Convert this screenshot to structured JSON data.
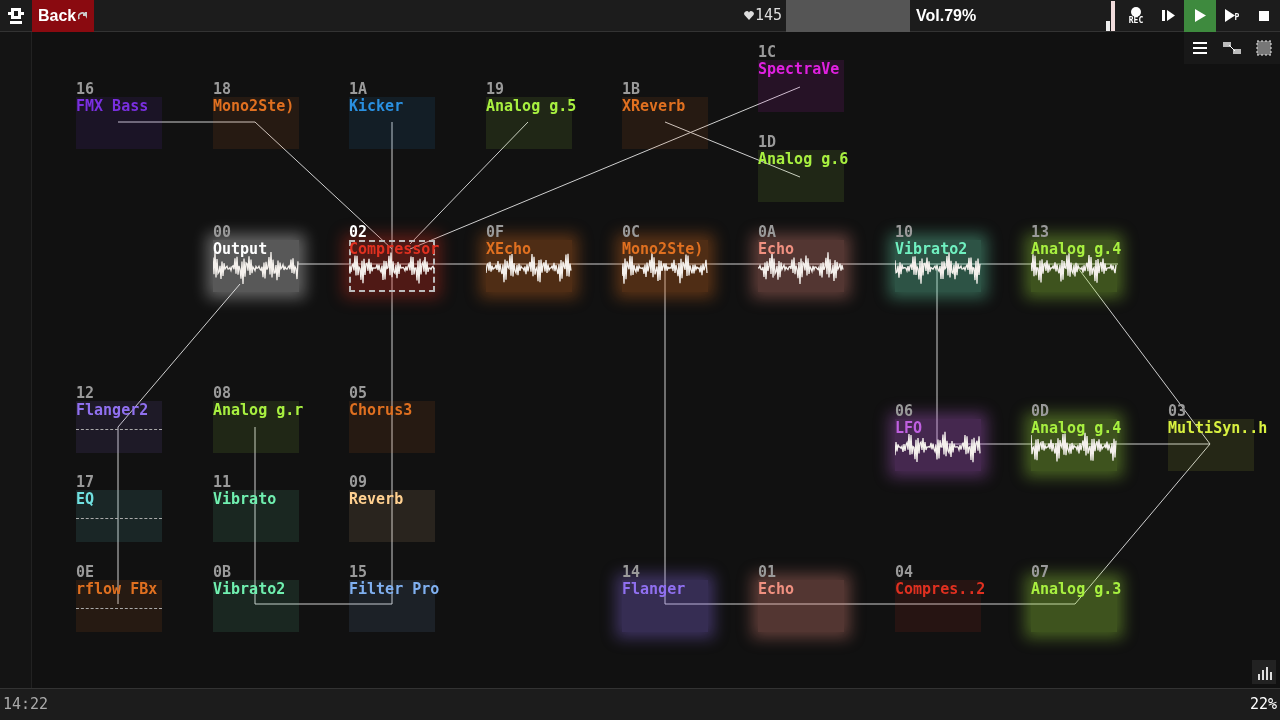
{
  "top_bar": {
    "back_button": "Back",
    "bpm": "145",
    "volume": "Vol.79%",
    "transport": [
      {
        "kind": "rec",
        "label": "REC",
        "selected": false
      },
      {
        "kind": "play_pattern",
        "selected": false
      },
      {
        "kind": "play",
        "selected": true
      },
      {
        "kind": "play_from",
        "label": "P",
        "selected": false
      },
      {
        "kind": "stop",
        "selected": false
      }
    ]
  },
  "modules": [
    {
      "id": "16",
      "name": "FMX Bass",
      "color": "#7a2fe0",
      "kind": "plain",
      "selected": false
    },
    {
      "id": "18",
      "name": "Mono2Ste)",
      "color": "#e07020",
      "kind": "plain",
      "selected": false
    },
    {
      "id": "1A",
      "name": "Kicker",
      "color": "#2a90e0",
      "kind": "plain",
      "selected": false
    },
    {
      "id": "19",
      "name": "Analog g.5",
      "color": "#a8f040",
      "kind": "plain",
      "selected": false
    },
    {
      "id": "1B",
      "name": "XReverb",
      "color": "#e07020",
      "kind": "plain",
      "selected": false
    },
    {
      "id": "1C",
      "name": "SpectraVe",
      "color": "#e020e0",
      "kind": "plain",
      "selected": false
    },
    {
      "id": "1D",
      "name": "Analog g.6",
      "color": "#a8f040",
      "kind": "plain",
      "selected": false
    },
    {
      "id": "00",
      "name": "Output",
      "color": "#ffffff",
      "kind": "wave",
      "selected": false
    },
    {
      "id": "02",
      "name": "Compressor",
      "color": "#e03020",
      "kind": "wave",
      "selected": true
    },
    {
      "id": "0F",
      "name": "XEcho",
      "color": "#e07020",
      "kind": "wave",
      "selected": false
    },
    {
      "id": "0C",
      "name": "Mono2Ste)",
      "color": "#e07020",
      "kind": "wave",
      "selected": false
    },
    {
      "id": "0A",
      "name": "Echo",
      "color": "#f09080",
      "kind": "wave",
      "selected": false
    },
    {
      "id": "10",
      "name": "Vibrato2",
      "color": "#70f0c0",
      "kind": "wave",
      "selected": false
    },
    {
      "id": "13",
      "name": "Analog g.4",
      "color": "#a8f040",
      "kind": "wave",
      "selected": false
    },
    {
      "id": "12",
      "name": "Flanger2",
      "color": "#9070f0",
      "kind": "dashed",
      "selected": false
    },
    {
      "id": "08",
      "name": "Analog g.r",
      "color": "#a8f040",
      "kind": "plain",
      "selected": false
    },
    {
      "id": "05",
      "name": "Chorus3",
      "color": "#e07020",
      "kind": "plain",
      "selected": false
    },
    {
      "id": "06",
      "name": "LFO",
      "color": "#c060e0",
      "kind": "wave",
      "selected": false
    },
    {
      "id": "0D",
      "name": "Analog g.4",
      "color": "#a8f040",
      "kind": "wave",
      "selected": false
    },
    {
      "id": "03",
      "name": "MultiSyn..h",
      "color": "#d8f040",
      "kind": "plain",
      "selected": false
    },
    {
      "id": "17",
      "name": "EQ",
      "color": "#70e0e0",
      "kind": "dashed",
      "selected": false
    },
    {
      "id": "11",
      "name": "Vibrato",
      "color": "#70f0b0",
      "kind": "plain",
      "selected": false
    },
    {
      "id": "09",
      "name": "Reverb",
      "color": "#ffd090",
      "kind": "plain",
      "selected": false
    },
    {
      "id": "0E",
      "name": "rflow FBx",
      "color": "#e07020",
      "kind": "dashed",
      "selected": false
    },
    {
      "id": "0B",
      "name": "Vibrato2",
      "color": "#70f0b0",
      "kind": "plain",
      "selected": false
    },
    {
      "id": "15",
      "name": "Filter Pro",
      "color": "#80b0f0",
      "kind": "plain",
      "selected": false
    },
    {
      "id": "14",
      "name": "Flanger",
      "color": "#9070f0",
      "kind": "glow",
      "selected": false
    },
    {
      "id": "01",
      "name": "Echo",
      "color": "#f09080",
      "kind": "glow",
      "selected": false
    },
    {
      "id": "04",
      "name": "Compres..2",
      "color": "#e03020",
      "kind": "plain",
      "selected": false
    },
    {
      "id": "07",
      "name": "Analog g.3",
      "color": "#a8f040",
      "kind": "glow",
      "selected": false
    }
  ],
  "status_bar": {
    "time": "14:22",
    "cpu": "22%"
  }
}
